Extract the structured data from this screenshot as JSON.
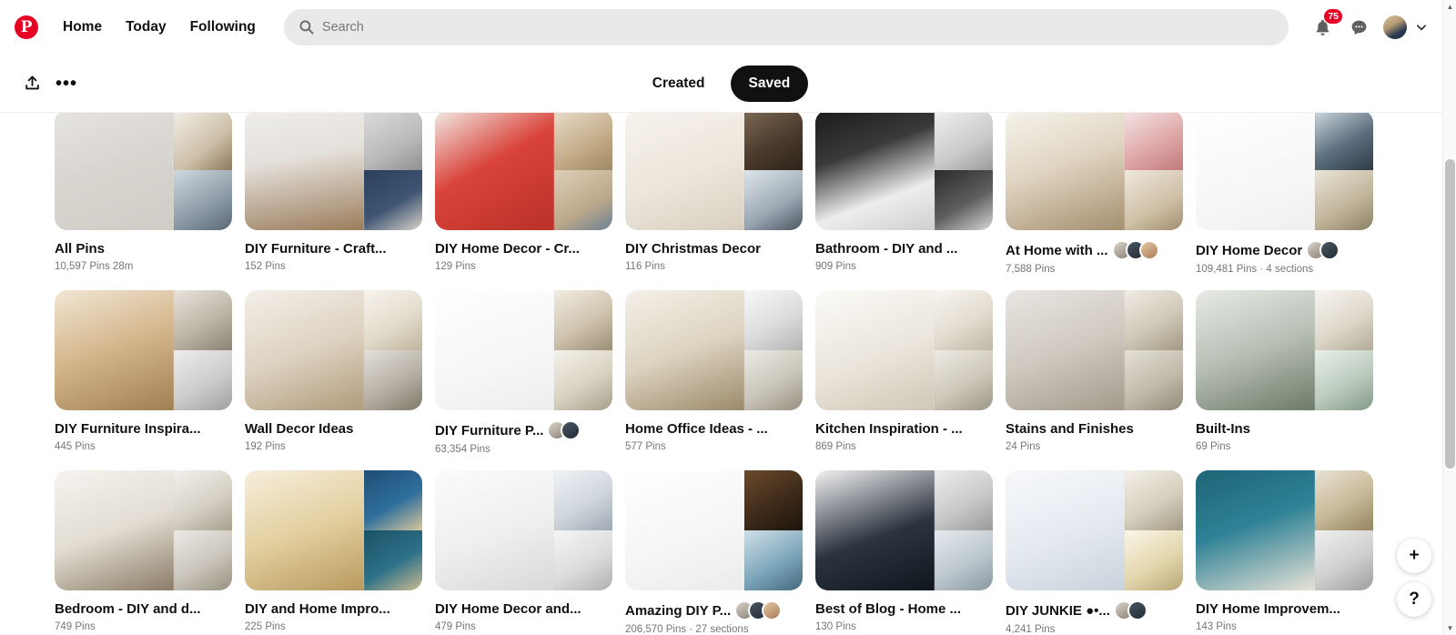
{
  "header": {
    "logo": "pinterest-logo",
    "nav": [
      {
        "label": "Home"
      },
      {
        "label": "Today"
      },
      {
        "label": "Following"
      }
    ],
    "search": {
      "placeholder": "Search",
      "value": "",
      "icon": "search-icon"
    },
    "notifications": {
      "icon": "bell-icon",
      "badge": "75"
    },
    "messages": {
      "icon": "message-bubble-icon"
    },
    "account": {
      "icon": "avatar",
      "chevron": "chevron-down-icon"
    }
  },
  "toolbar": {
    "share_icon": "upload-share-icon",
    "more_icon": "more-options-icon",
    "tabs": [
      {
        "label": "Created",
        "selected": false
      },
      {
        "label": "Saved",
        "selected": true
      }
    ]
  },
  "boards": [
    {
      "title": "All Pins",
      "meta": "10,597 Pins  28m",
      "collaborators": 0,
      "main": "linear-gradient(160deg,#e6e4e0 0%,#d9d6d0 45%,#cfccc6 100%)",
      "s1": "linear-gradient(140deg,#f3efe8 0%,#cdbfa8 60%,#8d7a5e 100%)",
      "s2": "linear-gradient(150deg,#cfd8df 0%,#8c9aa6 60%,#5a6875 100%)"
    },
    {
      "title": "DIY Furniture - Craft...",
      "meta": "152 Pins",
      "collaborators": 0,
      "main": "linear-gradient(170deg,#efeeec 0%,#e4e0da 40%,#9c7d5c 100%)",
      "s1": "linear-gradient(150deg,#dcdcdc 0%,#b9b9b9 60%,#8f8f8f 100%)",
      "s2": "linear-gradient(150deg,#2b3f5c 0%,#3f5573 55%,#d9d3c8 100%)"
    },
    {
      "title": "DIY Home Decor - Cr...",
      "meta": "129 Pins",
      "collaborators": 0,
      "main": "linear-gradient(150deg,#f2ece6 0%,#d9433a 45%,#b93128 100%)",
      "s1": "linear-gradient(150deg,#e8ddcb 0%,#c3ab87 60%,#9e8764 100%)",
      "s2": "linear-gradient(150deg,#dccfb8 0%,#bda98a 60%,#6b7f94 100%)"
    },
    {
      "title": "DIY Christmas Decor",
      "meta": "116 Pins",
      "collaborators": 0,
      "main": "linear-gradient(160deg,#f6f3ee 0%,#ece5da 55%,#d8cfc0 100%)",
      "s1": "linear-gradient(150deg,#7d6a55 0%,#4a3a2c 55%,#2c231b 100%)",
      "s2": "linear-gradient(150deg,#dfe6ea 0%,#9aa7b2 60%,#4a5660 100%)"
    },
    {
      "title": "Bathroom - DIY and ...",
      "meta": "909 Pins",
      "collaborators": 0,
      "main": "linear-gradient(160deg,#1b1b1b 0%,#3a3a3a 35%,#ededed 70%,#cfcfcf 100%)",
      "s1": "linear-gradient(150deg,#f0f0f0 0%,#cacaca 60%,#9b9b9b 100%)",
      "s2": "linear-gradient(150deg,#2a2a2a 0%,#5e5e5e 55%,#d7d7d7 100%)"
    },
    {
      "title": "At Home with ...",
      "meta": "7,588 Pins",
      "collaborators": 3,
      "main": "linear-gradient(160deg,#f6f3ec 0%,#e0d5c2 45%,#a58f6f 100%)",
      "s1": "linear-gradient(150deg,#f4e6e6 0%,#e0a9a9 55%,#c17a7a 100%)",
      "s2": "linear-gradient(150deg,#efe8dd 0%,#cfc0a6 60%,#a08d6d 100%)"
    },
    {
      "title": "DIY Home Decor",
      "meta": "109,481 Pins · 4 sections",
      "collaborators": 2,
      "main": "linear-gradient(160deg,#ffffff 0%,#f7f7f7 60%,#efefef 100%)",
      "s1": "linear-gradient(150deg,#cfd9df 0%,#5c6e7d 55%,#2f3b45 100%)",
      "s2": "linear-gradient(150deg,#e9e4d8 0%,#c3b79d 55%,#8d8164 100%)"
    },
    {
      "title": "DIY Furniture Inspira...",
      "meta": "445 Pins",
      "collaborators": 0,
      "main": "linear-gradient(160deg,#f1e6d4 0%,#d3b489 50%,#a07f52 100%)",
      "s1": "linear-gradient(150deg,#e8e4dd 0%,#bdb5a6 55%,#8a8274 100%)",
      "s2": "linear-gradient(150deg,#ededed 0%,#cdcdcd 55%,#9f9f9f 100%)"
    },
    {
      "title": "Wall Decor Ideas",
      "meta": "192 Pins",
      "collaborators": 0,
      "main": "linear-gradient(160deg,#f3efe9 0%,#ded3c2 50%,#b09b7c 100%)",
      "s1": "linear-gradient(150deg,#f7f4ed 0%,#e3dccd 55%,#c0b49c 100%)",
      "s2": "linear-gradient(150deg,#e3e0da 0%,#b6b0a4 55%,#7e776a 100%)"
    },
    {
      "title": "DIY Furniture P...",
      "meta": "63,354 Pins",
      "collaborators": 2,
      "main": "linear-gradient(160deg,#ffffff 0%,#f6f6f6 60%,#ededed 100%)",
      "s1": "linear-gradient(150deg,#f1ece2 0%,#cfc3ae 55%,#9b8e77 100%)",
      "s2": "linear-gradient(150deg,#f5f2ea 0%,#d9d2c2 55%,#a89f8b 100%)"
    },
    {
      "title": "Home Office Ideas - ...",
      "meta": "577 Pins",
      "collaborators": 0,
      "main": "linear-gradient(160deg,#f4f1ea 0%,#ddd3c0 50%,#9c8a6b 100%)",
      "s1": "linear-gradient(150deg,#f7f7f7 0%,#dcdcdc 55%,#b3b3b3 100%)",
      "s2": "linear-gradient(150deg,#eceae4 0%,#c9c5ba 55%,#95907f 100%)"
    },
    {
      "title": "Kitchen Inspiration - ...",
      "meta": "869 Pins",
      "collaborators": 0,
      "main": "linear-gradient(160deg,#fbfaf7 0%,#eae5db 55%,#cfc7b6 100%)",
      "s1": "linear-gradient(150deg,#f8f6f1 0%,#e2dcd0 55%,#bfb6a4 100%)",
      "s2": "linear-gradient(150deg,#edeae3 0%,#cdc8ba 55%,#9c9585 100%)"
    },
    {
      "title": "Stains and Finishes",
      "meta": "24 Pins",
      "collaborators": 0,
      "main": "linear-gradient(160deg,#e8e6e2 0%,#cfc9c0 50%,#a39a8c 100%)",
      "s1": "linear-gradient(150deg,#f0ece4 0%,#d0c8b8 55%,#a39883 100%)",
      "s2": "linear-gradient(150deg,#e4e0d7 0%,#c2bbab 55%,#928a77 100%)"
    },
    {
      "title": "Built-Ins",
      "meta": "69 Pins",
      "collaborators": 0,
      "main": "linear-gradient(160deg,#e8eae6 0%,#b7bfb4 50%,#6d7a68 100%)",
      "s1": "linear-gradient(150deg,#f7f5f0 0%,#ded8cb 55%,#b4ab97 100%)",
      "s2": "linear-gradient(150deg,#e9f0ea 0%,#bccbbe 55%,#83998a 100%)"
    },
    {
      "title": "Bedroom - DIY and d...",
      "meta": "749 Pins",
      "collaborators": 0,
      "main": "linear-gradient(160deg,#f6f4ef 0%,#e2ddd3 50%,#8b7c66 100%)",
      "s1": "linear-gradient(150deg,#f2f0ec 0%,#d6d1c6 55%,#a79f8f 100%)",
      "s2": "linear-gradient(150deg,#eceae6 0%,#cac5bb 55%,#96907f 100%)"
    },
    {
      "title": "DIY and Home Impro...",
      "meta": "225 Pins",
      "collaborators": 0,
      "main": "linear-gradient(160deg,#f6efdd 0%,#e3cf9f 50%,#b99a5f 100%)",
      "s1": "linear-gradient(150deg,#1f4d74 0%,#2f6f9c 55%,#d7c79b 100%)",
      "s2": "linear-gradient(150deg,#1b5266 0%,#2d7188 55%,#cdbb8f 100%)"
    },
    {
      "title": "DIY Home Decor and...",
      "meta": "479 Pins",
      "collaborators": 0,
      "main": "linear-gradient(160deg,#fbfbfb 0%,#eeeeee 55%,#d8d8d8 100%)",
      "s1": "linear-gradient(150deg,#f0f2f5 0%,#cfd6dd 55%,#9fa9b3 100%)",
      "s2": "linear-gradient(150deg,#f5f5f5 0%,#dcdcdc 55%,#b0b0b0 100%)"
    },
    {
      "title": "Amazing DIY P...",
      "meta": "206,570 Pins · 27 sections",
      "collaborators": 3,
      "main": "linear-gradient(160deg,#ffffff 0%,#f5f5f5 60%,#ebebeb 100%)",
      "s1": "linear-gradient(150deg,#6b4a2c 0%,#3d2a19 55%,#1e150d 100%)",
      "s2": "linear-gradient(150deg,#cfe0e8 0%,#7fa7bb 55%,#42687d 100%)"
    },
    {
      "title": "Best of Blog - Home ...",
      "meta": "130 Pins",
      "collaborators": 0,
      "main": "linear-gradient(160deg,#f2f2f2 0%,#2c3440 55%,#10161d 100%)",
      "s1": "linear-gradient(150deg,#ededed 0%,#c9c9c9 55%,#9a9a9a 100%)",
      "s2": "linear-gradient(150deg,#e6ebef 0%,#bcc7ce 55%,#8897a1 100%)"
    },
    {
      "title": "DIY JUNKIE ●•...",
      "meta": "4,241 Pins",
      "collaborators": 2,
      "main": "linear-gradient(160deg,#f7f8fa 0%,#e6ebf1 50%,#c9d3dc 100%)",
      "s1": "linear-gradient(150deg,#f3f0e9 0%,#d6cfbe 55%,#a39a85 100%)",
      "s2": "linear-gradient(150deg,#fbf6e8 0%,#e3d7ae 55%,#b9a878 100%)"
    },
    {
      "title": "DIY Home Improvem...",
      "meta": "143 Pins",
      "collaborators": 0,
      "main": "linear-gradient(160deg,#1d6476 0%,#2f8296 45%,#e8e2d6 100%)",
      "s1": "linear-gradient(150deg,#e9e3d6 0%,#c7b998 55%,#95855f 100%)",
      "s2": "linear-gradient(150deg,#f0f0f0 0%,#cfcfcf 55%,#9e9e9e 100%)"
    }
  ],
  "floating": {
    "create_label": "+",
    "help_label": "?"
  },
  "scrollbar": {
    "up": "▲",
    "down": "▼"
  }
}
